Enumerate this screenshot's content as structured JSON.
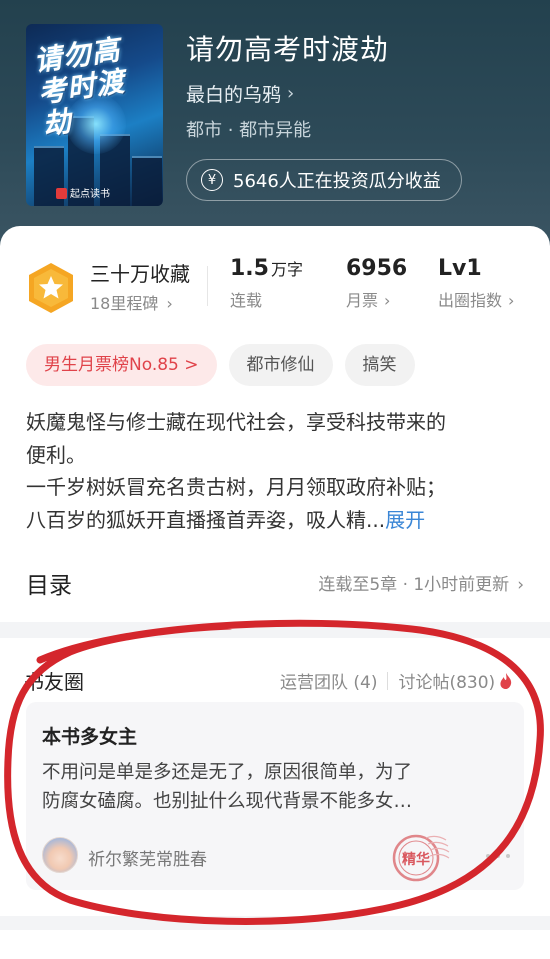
{
  "book": {
    "title": "请勿高考时渡劫",
    "author": "最白的乌鸦",
    "genre": "都市 · 都市异能",
    "invest_label": "5646人正在投资瓜分收益",
    "cover_title": "请勿高考时渡劫",
    "cover_publisher": "起点读书"
  },
  "stats": {
    "favorites": {
      "title": "三十万收藏",
      "subtitle": "18里程碑"
    },
    "words": {
      "value": "1.5",
      "unit": "万字",
      "label": "连载"
    },
    "monthly_votes": {
      "value": "6956",
      "label": "月票"
    },
    "breakout": {
      "value": "Lv1",
      "label": "出圈指数"
    }
  },
  "tags": [
    "男生月票榜No.85 >",
    "都市修仙",
    "搞笑"
  ],
  "description": {
    "line1": "妖魔鬼怪与修士藏在现代社会，享受科技带来的",
    "line2": "便利。",
    "line3": "一千岁树妖冒充名贵古树，月月领取政府补贴；",
    "line4": "八百岁的狐妖开直播搔首弄姿，吸人精...",
    "expand": "展开"
  },
  "toc": {
    "title": "目录",
    "info": "连载至5章 · 1小时前更新"
  },
  "friends": {
    "title": "书友圈",
    "ops": "运营团队 (4)",
    "posts": "讨论帖(830)",
    "post": {
      "title": "本书多女主",
      "line1": "不用问是单是多还是无了，原因很简单，为了",
      "line2": "防腐女磕腐。也别扯什么现代背景不能多女…",
      "user": "祈尔繁芜常胜春",
      "stamp": "精华"
    }
  },
  "colors": {
    "header_bg": "#2d4a58",
    "accent_red": "#e0434a",
    "link_blue": "#3a86d6",
    "badge_orange": "#f5a623",
    "annotation_red": "#d4262c"
  },
  "icons": {
    "yen": "yen-coin-icon",
    "chevron": "chevron-right-icon",
    "badge": "star-hexagon-badge-icon",
    "fire": "fire-icon"
  }
}
